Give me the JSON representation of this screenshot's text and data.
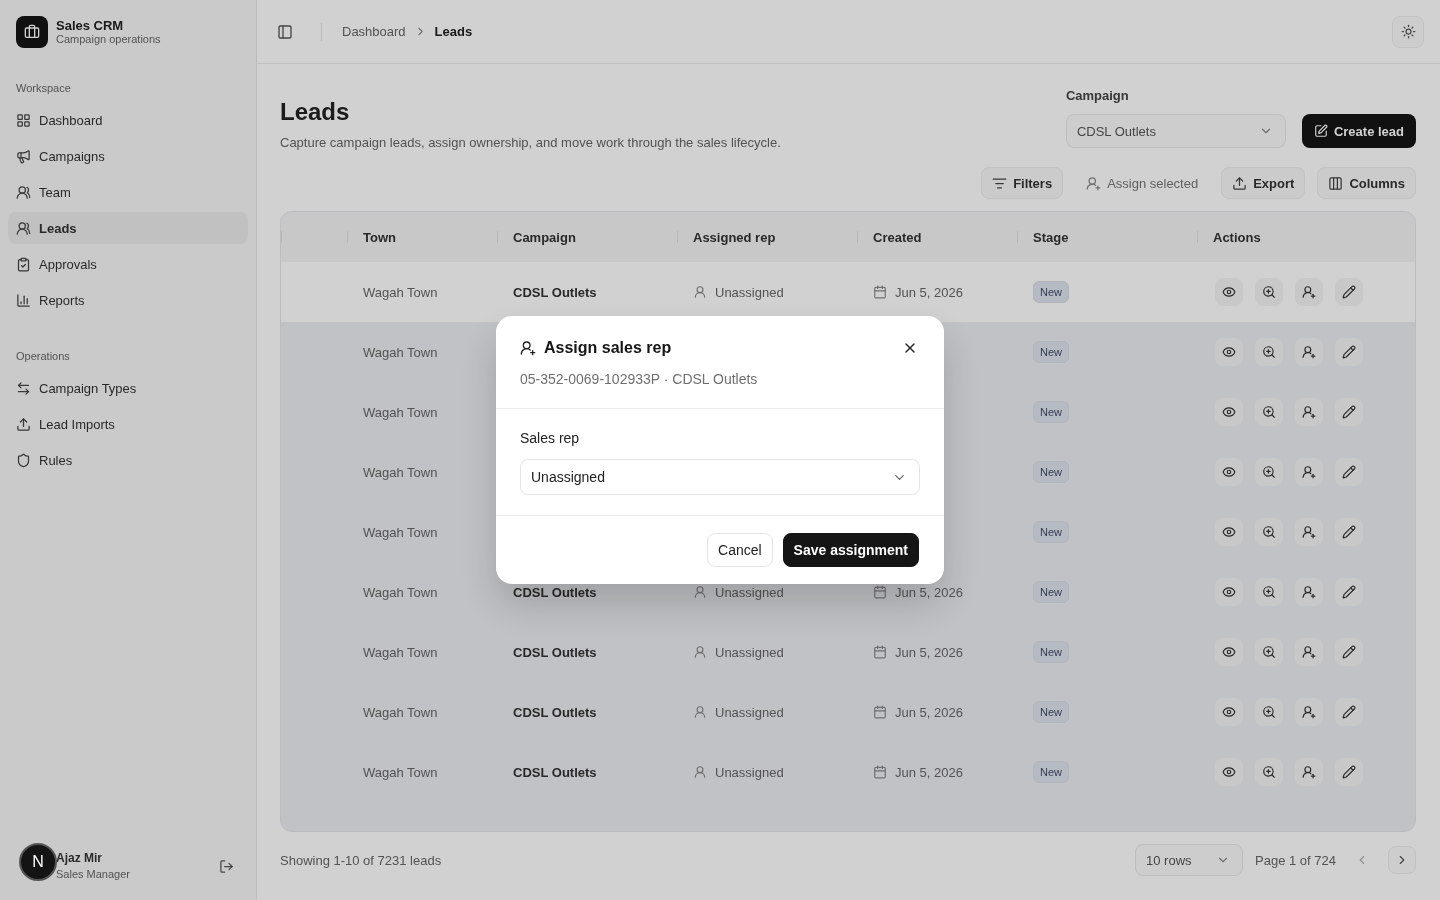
{
  "sidebar": {
    "brand": {
      "title": "Sales CRM",
      "subtitle": "Campaign operations"
    },
    "sections": [
      {
        "label": "Workspace",
        "items": [
          {
            "label": "Dashboard",
            "selected": false
          },
          {
            "label": "Campaigns",
            "selected": false
          },
          {
            "label": "Team",
            "selected": false
          },
          {
            "label": "Leads",
            "selected": true
          },
          {
            "label": "Approvals",
            "selected": false
          },
          {
            "label": "Reports",
            "selected": false
          }
        ]
      },
      {
        "label": "Operations",
        "items": [
          {
            "label": "Campaign Types",
            "selected": false
          },
          {
            "label": "Lead Imports",
            "selected": false
          },
          {
            "label": "Rules",
            "selected": false
          }
        ]
      }
    ],
    "user": {
      "name": "Ajaz Mir",
      "role": "Sales Manager"
    }
  },
  "header": {
    "breadcrumb": [
      {
        "label": "Dashboard",
        "current": false
      },
      {
        "label": "Leads",
        "current": true
      }
    ]
  },
  "page": {
    "title": "Leads",
    "subtitle": "Capture campaign leads, assign ownership, and move work through the sales lifecycle.",
    "campaign_filter": {
      "label": "Campaign",
      "value": "CDSL Outlets"
    },
    "create_button": "Create lead",
    "toolbar": [
      {
        "label": "Filters",
        "disabled": false
      },
      {
        "label": "Assign selected",
        "disabled": true
      },
      {
        "label": "Export",
        "disabled": false
      },
      {
        "label": "Columns",
        "disabled": false
      }
    ]
  },
  "table": {
    "columns": [
      "Town",
      "Campaign",
      "Assigned rep",
      "Created",
      "Stage",
      "Actions"
    ],
    "rows": [
      {
        "town": "Wagah Town",
        "campaign": "CDSL Outlets",
        "assigned_rep": "Unassigned",
        "created": "Jun 5, 2026",
        "stage": "New",
        "hovered": true
      },
      {
        "town": "Wagah Town",
        "stage": "New",
        "hovered": false
      },
      {
        "town": "Wagah Town",
        "stage": "New",
        "hovered": false
      },
      {
        "town": "Wagah Town",
        "stage": "New",
        "hovered": false
      },
      {
        "town": "Wagah Town",
        "stage": "New",
        "hovered": false
      },
      {
        "town": "Wagah Town",
        "campaign": "CDSL Outlets",
        "assigned_rep": "Unassigned",
        "created": "Jun 5, 2026",
        "stage": "New",
        "hovered": false
      },
      {
        "town": "Wagah Town",
        "campaign": "CDSL Outlets",
        "assigned_rep": "Unassigned",
        "created": "Jun 5, 2026",
        "stage": "New",
        "hovered": false
      },
      {
        "town": "Wagah Town",
        "campaign": "CDSL Outlets",
        "assigned_rep": "Unassigned",
        "created": "Jun 5, 2026",
        "stage": "New",
        "hovered": false
      },
      {
        "town": "Wagah Town",
        "campaign": "CDSL Outlets",
        "assigned_rep": "Unassigned",
        "created": "Jun 5, 2026",
        "stage": "New",
        "hovered": false
      }
    ]
  },
  "footer": {
    "summary": "Showing 1-10 of 7231 leads",
    "page_size": "10 rows",
    "page": "Page 1 of 724",
    "previous": {
      "disabled": true
    },
    "next": {
      "disabled": false
    }
  },
  "dialog": {
    "title": "Assign sales rep",
    "subtitle": "05-352-0069-102933P · CDSL Outlets",
    "field": {
      "label": "Sales rep",
      "value": "Unassigned"
    },
    "buttons": [
      {
        "label": "Cancel",
        "kind": "secondary"
      },
      {
        "label": "Save assignment",
        "kind": "primary"
      }
    ]
  },
  "dev_indicator": {
    "label": "N"
  }
}
